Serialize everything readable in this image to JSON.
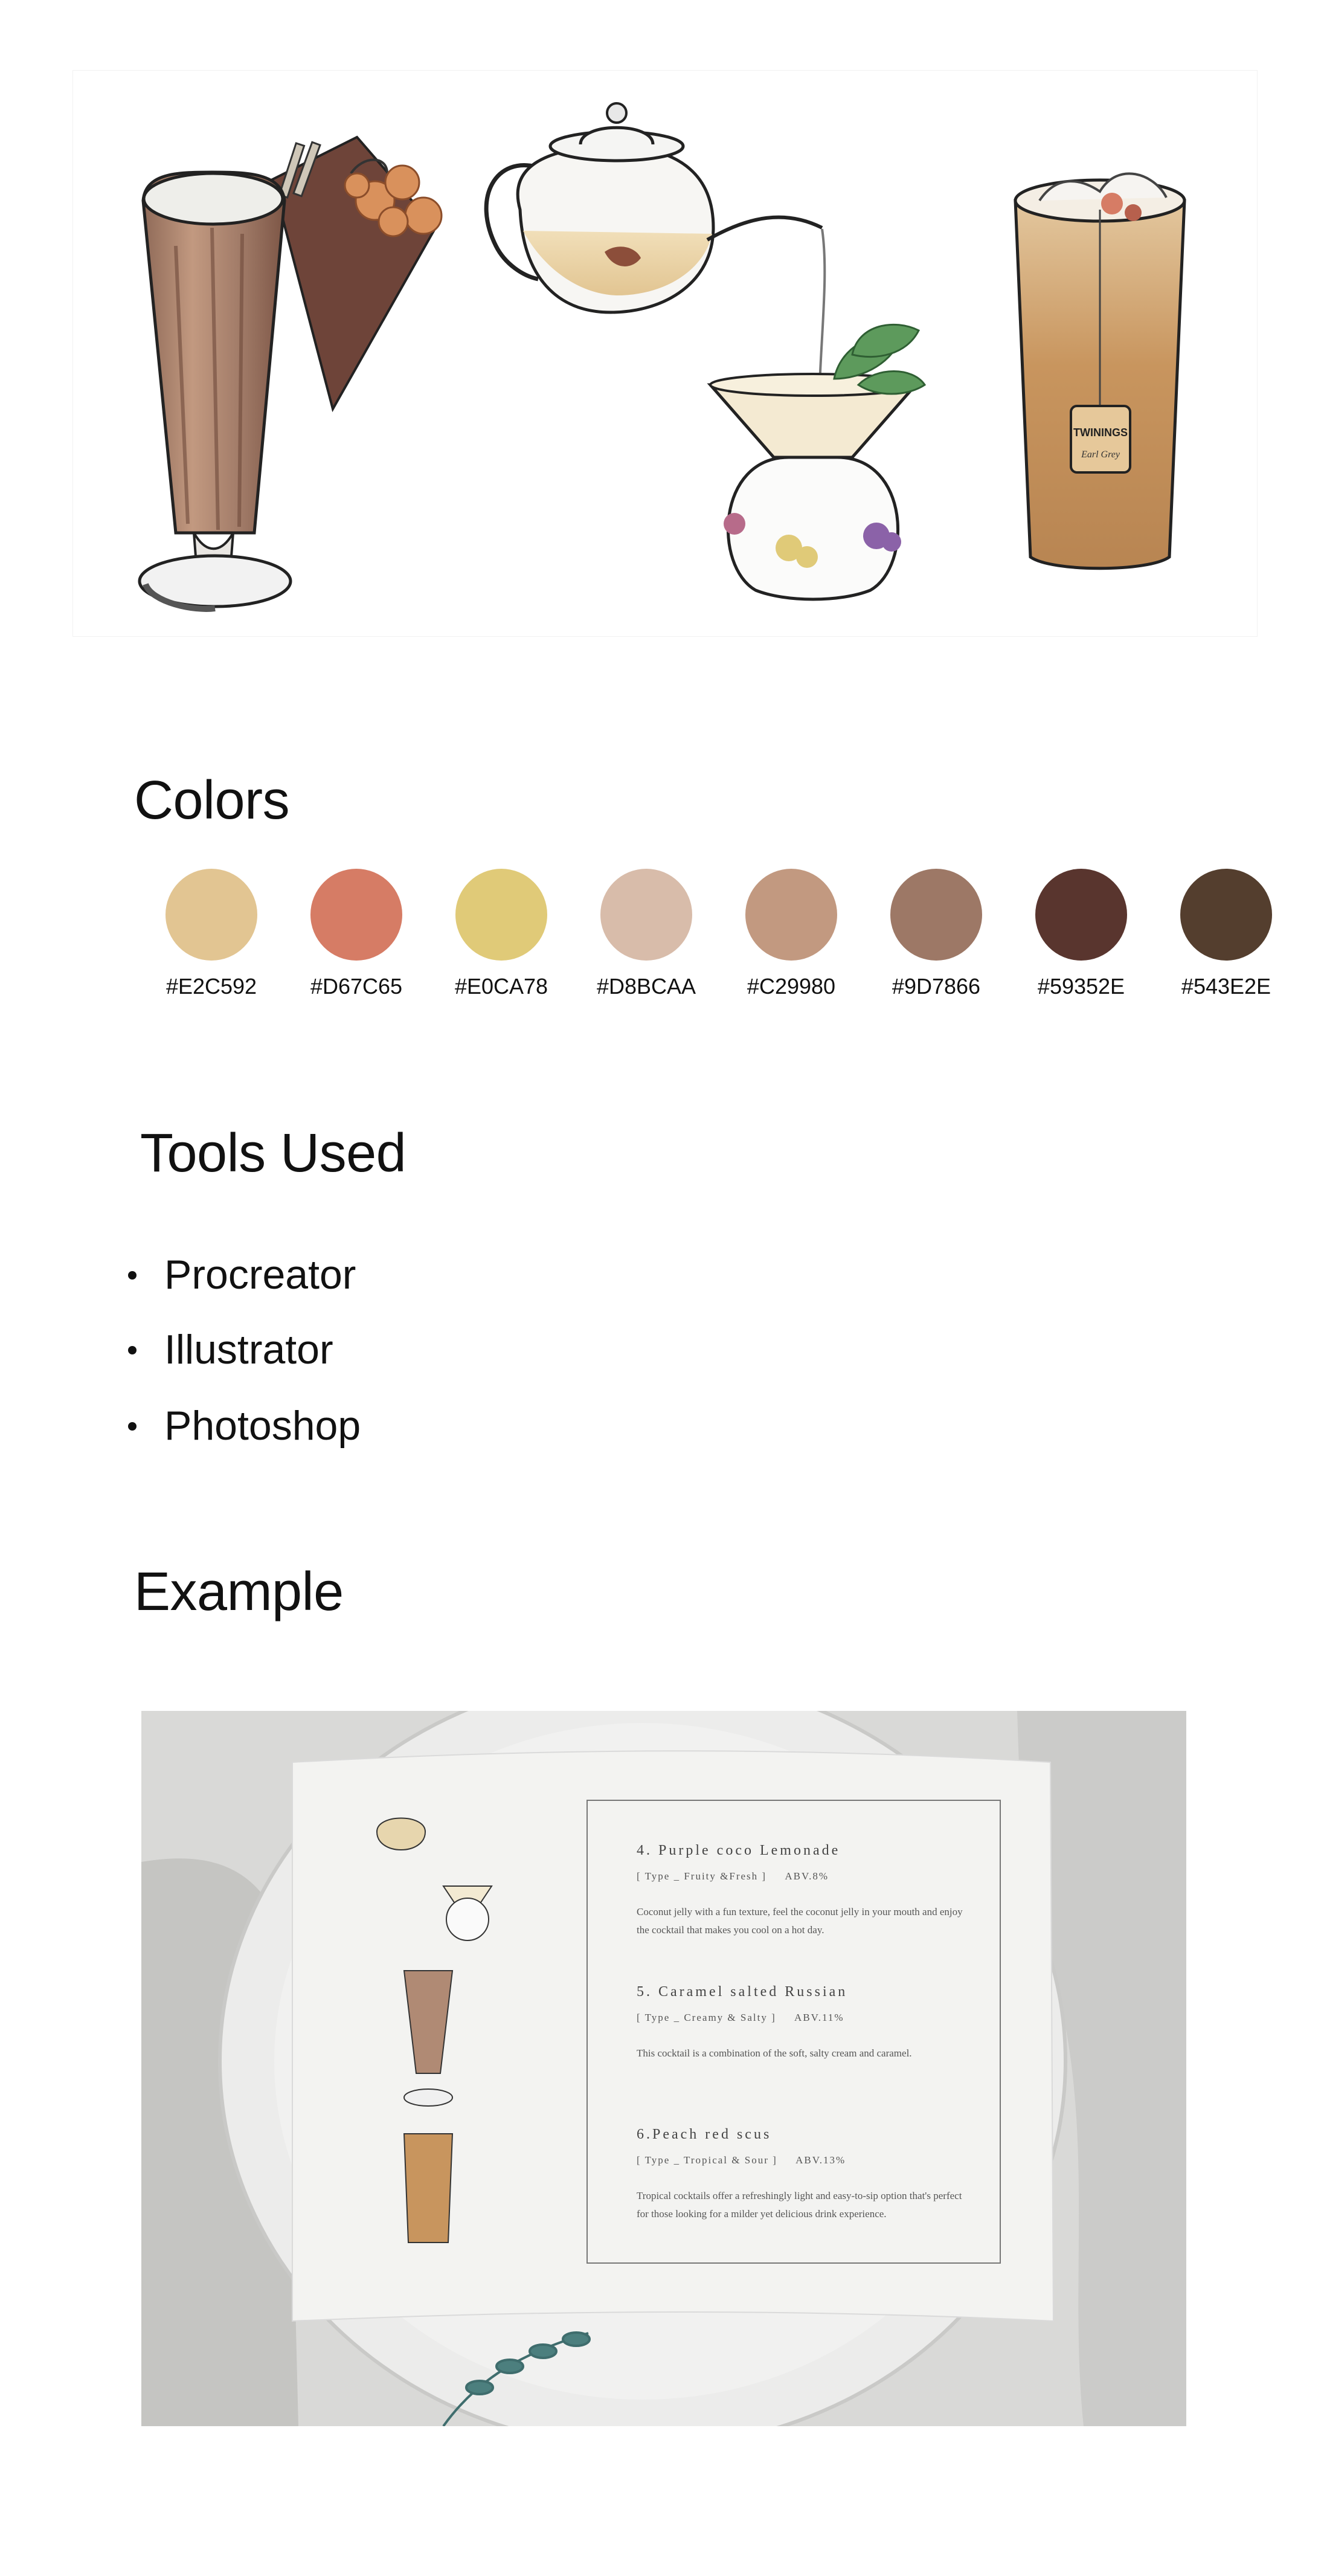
{
  "sections": {
    "colors_title": "Colors",
    "tools_title": "Tools Used",
    "example_title": "Example"
  },
  "colors": [
    {
      "hex": "#E2C592",
      "label": "#E2C592"
    },
    {
      "hex": "#D67C65",
      "label": "#D67C65"
    },
    {
      "hex": "#E0CA78",
      "label": "#E0CA78"
    },
    {
      "hex": "#D8BCAA",
      "label": "#D8BCAA"
    },
    {
      "hex": "#C29980",
      "label": "#C29980"
    },
    {
      "hex": "#9D7866",
      "label": "#9D7866"
    },
    {
      "hex": "#59352E",
      "label": "#59352E"
    },
    {
      "hex": "#543E2E",
      "label": "#543E2E"
    }
  ],
  "tools": [
    "Procreator",
    "Illustrator",
    "Photoshop"
  ],
  "hero": {
    "tea_tag_text": "TWININGS",
    "tea_tag_sub": "Earl Grey"
  },
  "menu": {
    "items": [
      {
        "title": "4. Purple coco Lemonade",
        "meta": "[ Type _ Fruity &Fresh ]     ABV.8%",
        "desc": "Coconut jelly with a fun texture, feel the coconut jelly in your mouth and enjoy the cocktail that makes you cool on a hot day."
      },
      {
        "title": "5. Caramel salted Russian",
        "meta": "[ Type _ Creamy & Salty ]     ABV.11%",
        "desc": "This cocktail is a combination of the soft, salty cream and caramel."
      },
      {
        "title": "6.Peach red scus",
        "meta": "[ Type _ Tropical & Sour ]     ABV.13%",
        "desc": "Tropical cocktails offer a refreshingly light and easy-to-sip option that's perfect for those looking for a milder yet delicious drink experience."
      }
    ]
  }
}
